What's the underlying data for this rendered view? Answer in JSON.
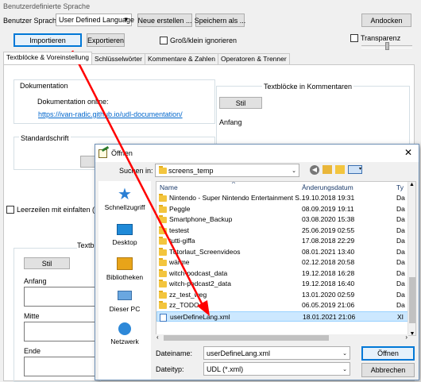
{
  "window": {
    "title": "Benutzerdefinierte Sprache"
  },
  "toolbar": {
    "language_label": "Benutzer Sprache:",
    "language_value": "User Defined Language",
    "new_button": "Neue erstellen ...",
    "saveas_button": "Speichern als ...",
    "dock_button": "Andocken",
    "import_button": "Importieren",
    "export_button": "Exportieren",
    "ignore_case_label": "Groß/klein ignorieren",
    "transparency_label": "Transparenz",
    "transparency_level": 0.5
  },
  "tabs": [
    {
      "label": "Textblöcke & Voreinstellung"
    },
    {
      "label": "Schlüsselwörter"
    },
    {
      "label": "Kommentare & Zahlen"
    },
    {
      "label": "Operatoren & Trenner"
    }
  ],
  "panel": {
    "doc_group_title": "Dokumentation",
    "doc_online_label": "Dokumentation online:",
    "doc_link": "https://ivan-radic.github.io/udl-documentation/",
    "default_font_title": "Standardschrift",
    "comments_group_title": "Textblöcke in Kommentaren",
    "style_button": "Stil",
    "start_label": "Anfang",
    "wrap_label": "Leerzeilen mit einfalten (k",
    "textblocks_title": "Textblö",
    "style_button2": "Stil",
    "start_label2": "Anfang",
    "middle_label": "Mitte",
    "end_label": "Ende"
  },
  "dialog": {
    "title": "Öffnen",
    "search_in_label": "Suchen in:",
    "search_in_value": "screens_temp",
    "places": [
      {
        "label": "Schnellzugriff",
        "icon": "star-icon"
      },
      {
        "label": "Desktop",
        "icon": "desktop-icon"
      },
      {
        "label": "Bibliotheken",
        "icon": "library-icon"
      },
      {
        "label": "Dieser PC",
        "icon": "computer-icon"
      },
      {
        "label": "Netzwerk",
        "icon": "network-icon"
      }
    ],
    "columns": {
      "name": "Name",
      "date": "Änderungsdatum",
      "type": "Ty"
    },
    "files": [
      {
        "name": "Nintendo - Super Nintendo Entertainment S...",
        "date": "19.10.2018 19:31",
        "type": "Da"
      },
      {
        "name": "Peggle",
        "date": "08.09.2019 19:11",
        "type": "Da"
      },
      {
        "name": "Smartphone_Backup",
        "date": "03.08.2020 15:38",
        "type": "Da"
      },
      {
        "name": "testest",
        "date": "25.06.2019 02:55",
        "type": "Da"
      },
      {
        "name": "tutti-giffa",
        "date": "17.08.2018 22:29",
        "type": "Da"
      },
      {
        "name": "Tutorlaut_Screenvideos",
        "date": "08.01.2021 13:40",
        "type": "Da"
      },
      {
        "name": "wärme",
        "date": "02.12.2018 20:58",
        "type": "Da"
      },
      {
        "name": "witch-podcast_data",
        "date": "19.12.2018 16:28",
        "type": "Da"
      },
      {
        "name": "witch-podcast2_data",
        "date": "19.12.2018 16:40",
        "type": "Da"
      },
      {
        "name": "zz_test_weg",
        "date": "13.01.2020 02:59",
        "type": "Da"
      },
      {
        "name": "zz_TODO",
        "date": "06.05.2019 21:06",
        "type": "Da"
      },
      {
        "name": "userDefineLang.xml",
        "date": "18.01.2021 21:06",
        "type": "XI",
        "selected": true,
        "file": true
      }
    ],
    "filename_label": "Dateiname:",
    "filename_value": "userDefineLang.xml",
    "filetype_label": "Dateityp:",
    "filetype_value": "UDL (*.xml)",
    "open_button": "Öffnen",
    "cancel_button": "Abbrechen"
  },
  "colors": {
    "arrow": "#ff0000",
    "link": "#0066cc",
    "selection": "#cce8ff"
  }
}
